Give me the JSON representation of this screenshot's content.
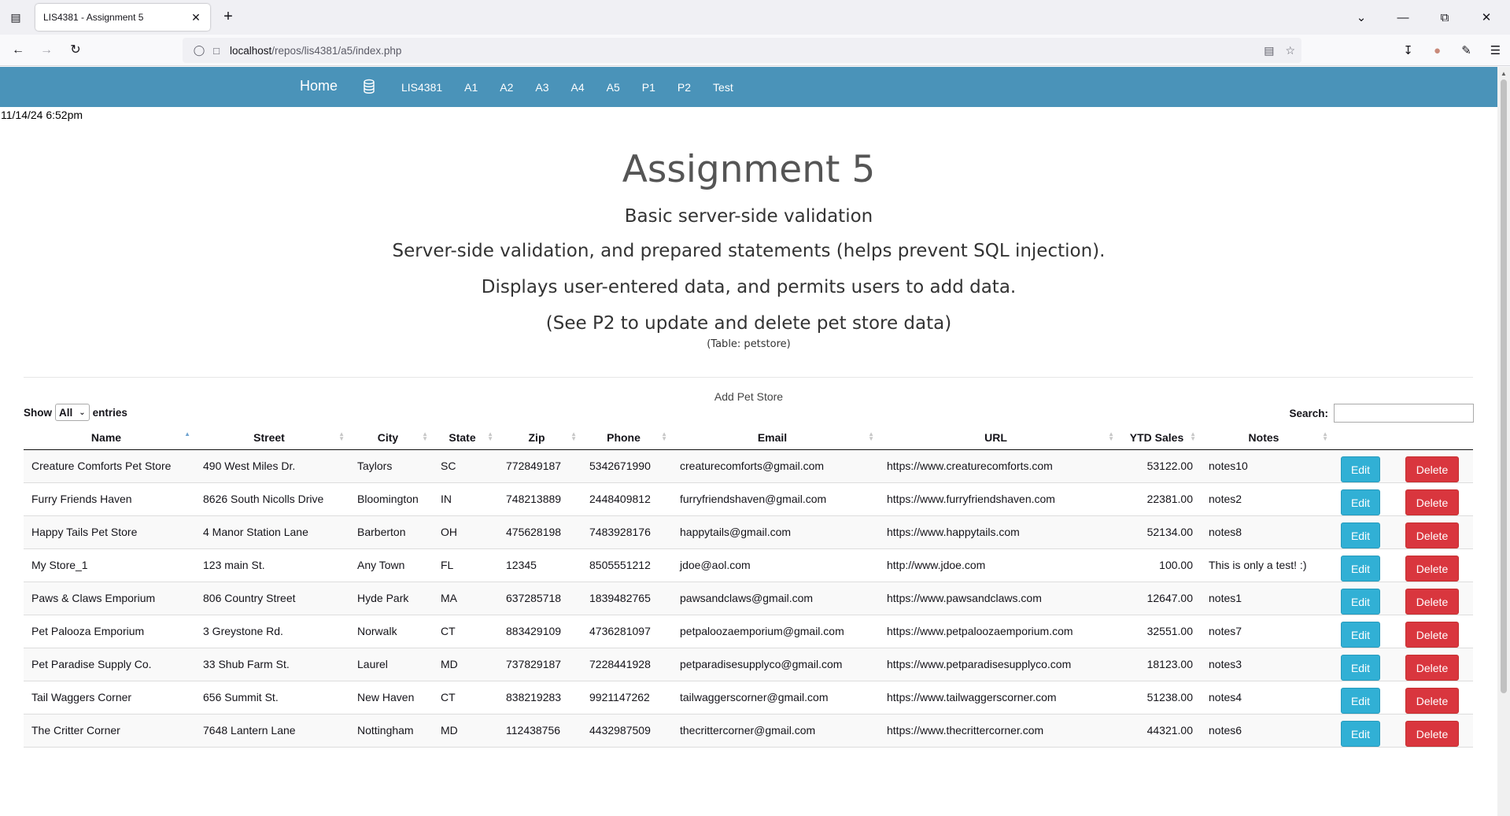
{
  "browser": {
    "tab_title": "LIS4381 - Assignment 5",
    "url_host": "localhost",
    "url_path": "/repos/lis4381/a5/index.php"
  },
  "site": {
    "brand": "Home",
    "nav_links": [
      "LIS4381",
      "A1",
      "A2",
      "A3",
      "A4",
      "A5",
      "P1",
      "P2",
      "Test"
    ],
    "nav_color": "#4a93b9"
  },
  "timestamp": "11/14/24 6:52pm",
  "hero": {
    "title": "Assignment 5",
    "subtitle": "Basic server-side validation",
    "line1": "Server-side validation, and prepared statements (helps prevent SQL injection).",
    "line2": "Displays user-entered data, and permits users to add data.",
    "line3": "(See P2 to update and delete pet store data)",
    "table_note": "(Table: petstore)"
  },
  "add_link": "Add Pet Store",
  "controls": {
    "show_label": "Show",
    "entries_value": "All",
    "entries_label": "entries",
    "search_label": "Search:"
  },
  "table": {
    "columns": [
      "Name",
      "Street",
      "City",
      "State",
      "Zip",
      "Phone",
      "Email",
      "URL",
      "YTD Sales",
      "Notes"
    ],
    "edit_label": "Edit",
    "delete_label": "Delete",
    "rows": [
      [
        "Creature Comforts Pet Store",
        "490 West Miles Dr.",
        "Taylors",
        "SC",
        "772849187",
        "5342671990",
        "creaturecomforts@gmail.com",
        "https://www.creaturecomforts.com",
        "53122.00",
        "notes10"
      ],
      [
        "Furry Friends Haven",
        "8626 South Nicolls Drive",
        "Bloomington",
        "IN",
        "748213889",
        "2448409812",
        "furryfriendshaven@gmail.com",
        "https://www.furryfriendshaven.com",
        "22381.00",
        "notes2"
      ],
      [
        "Happy Tails Pet Store",
        "4 Manor Station Lane",
        "Barberton",
        "OH",
        "475628198",
        "7483928176",
        "happytails@gmail.com",
        "https://www.happytails.com",
        "52134.00",
        "notes8"
      ],
      [
        "My Store_1",
        "123 main St.",
        "Any Town",
        "FL",
        "12345",
        "8505551212",
        "jdoe@aol.com",
        "http://www.jdoe.com",
        "100.00",
        "This is only a test! :)"
      ],
      [
        "Paws & Claws Emporium",
        "806 Country Street",
        "Hyde Park",
        "MA",
        "637285718",
        "1839482765",
        "pawsandclaws@gmail.com",
        "https://www.pawsandclaws.com",
        "12647.00",
        "notes1"
      ],
      [
        "Pet Palooza Emporium",
        "3 Greystone Rd.",
        "Norwalk",
        "CT",
        "883429109",
        "4736281097",
        "petpaloozaemporium@gmail.com",
        "https://www.petpaloozaemporium.com",
        "32551.00",
        "notes7"
      ],
      [
        "Pet Paradise Supply Co.",
        "33 Shub Farm St.",
        "Laurel",
        "MD",
        "737829187",
        "7228441928",
        "petparadisesupplyco@gmail.com",
        "https://www.petparadisesupplyco.com",
        "18123.00",
        "notes3"
      ],
      [
        "Tail Waggers Corner",
        "656 Summit St.",
        "New Haven",
        "CT",
        "838219283",
        "9921147262",
        "tailwaggerscorner@gmail.com",
        "https://www.tailwaggerscorner.com",
        "51238.00",
        "notes4"
      ],
      [
        "The Critter Corner",
        "7648 Lantern Lane",
        "Nottingham",
        "MD",
        "112438756",
        "4432987509",
        "thecrittercorner@gmail.com",
        "https://www.thecrittercorner.com",
        "44321.00",
        "notes6"
      ]
    ]
  }
}
